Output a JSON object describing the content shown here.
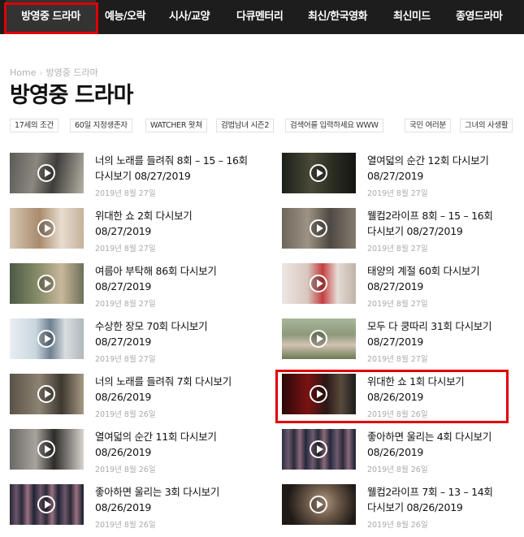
{
  "nav": {
    "items": [
      {
        "label": "방영중 드라마"
      },
      {
        "label": "예능/오락"
      },
      {
        "label": "시사/교양"
      },
      {
        "label": "다큐멘터리"
      },
      {
        "label": "최신/한국영화"
      },
      {
        "label": "최신미드"
      },
      {
        "label": "종영드라마"
      }
    ]
  },
  "breadcrumb": {
    "home": "Home",
    "separator": "›",
    "current": "방영중 드라마"
  },
  "page_title": "방영중 드라마",
  "tags": [
    "17세의 조건",
    "60일 지정생존자",
    "WATCHER 왓쳐",
    "검법남녀 시즌2",
    "검색어를 입력하세요 WWW",
    "국민 여러분",
    "그녀의 사생활"
  ],
  "posts": [
    {
      "title": "너의 노래를 들려줘 8회 – 15 – 16회 다시보기 08/27/2019",
      "date": "2019년 8월 27일"
    },
    {
      "title": "열여덟의 순간 12회 다시보기 08/27/2019",
      "date": "2019년 8월 27일"
    },
    {
      "title": "위대한 쇼 2회 다시보기 08/27/2019",
      "date": "2019년 8월 27일"
    },
    {
      "title": "웰컴2라이프 8회 – 15 – 16회 다시보기 08/27/2019",
      "date": "2019년 8월 27일"
    },
    {
      "title": "여름아 부탁해 86회 다시보기 08/27/2019",
      "date": "2019년 8월 27일"
    },
    {
      "title": "태양의 계절 60회 다시보기 08/27/2019",
      "date": "2019년 8월 27일"
    },
    {
      "title": "수상한 장모 70회 다시보기 08/27/2019",
      "date": "2019년 8월 27일"
    },
    {
      "title": "모두 다 쿵따리 31회 다시보기 08/27/2019",
      "date": "2019년 8월 27일"
    },
    {
      "title": "너의 노래를 들려줘 7회 다시보기 08/26/2019",
      "date": "2019년 8월 26일"
    },
    {
      "title": "위대한 쇼 1회 다시보기 08/26/2019",
      "date": "2019년 8월 26일"
    },
    {
      "title": "열여덟의 순간 11회 다시보기 08/26/2019",
      "date": "2019년 8월 26일"
    },
    {
      "title": "좋아하면 울리는 4회 다시보기 08/26/2019",
      "date": "2019년 8월 26일"
    },
    {
      "title": "좋아하면 울리는 3회 다시보기 08/26/2019",
      "date": "2019년 8월 26일"
    },
    {
      "title": "웰컴2라이프 7회 – 13 – 14회 다시보기 08/26/2019",
      "date": "2019년 8월 26일"
    }
  ],
  "colors": {
    "nav_bg": "#1d1d1d",
    "highlight": "#e00000",
    "muted": "#aaaaaa"
  }
}
